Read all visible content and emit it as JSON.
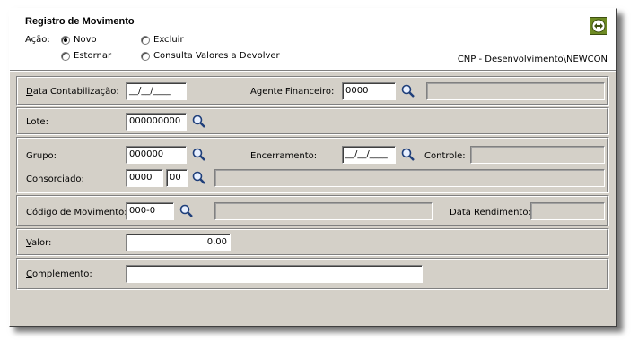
{
  "header": {
    "title": "Registro de Movimento",
    "acao_label": "Ação:",
    "options": {
      "novo": "Novo",
      "excluir": "Excluir",
      "estornar": "Estornar",
      "consulta": "Consulta Valores a Devolver"
    },
    "selected": "Novo",
    "server": "CNP - Desenvolvimento\\NEWCON"
  },
  "fields": {
    "data_contabilizacao": {
      "label": "Data Contabilização:",
      "value": "__/__/____"
    },
    "agente_financeiro": {
      "label": "Agente Financeiro:",
      "value": "0000",
      "description": ""
    },
    "lote": {
      "label": "Lote:",
      "value": "000000000"
    },
    "grupo": {
      "label": "Grupo:",
      "value": "000000"
    },
    "encerramento": {
      "label": "Encerramento:",
      "value": "__/__/____"
    },
    "controle": {
      "label": "Controle:",
      "value": ""
    },
    "consorciado": {
      "label": "Consorciado:",
      "value1": "0000",
      "value2": "00",
      "description": ""
    },
    "codigo_movimento": {
      "label": "Código de Movimento:",
      "value": "000-0",
      "description": ""
    },
    "data_rendimento": {
      "label": "Data Rendimento:",
      "value": ""
    },
    "valor": {
      "label": "Valor:",
      "value": "0,00"
    },
    "complemento": {
      "label": "Complemento:",
      "value": ""
    }
  },
  "icons": {
    "search": "magnifier-icon",
    "nav": "arrows-icon"
  },
  "colors": {
    "window_bg": "#d4d0c8",
    "header_bg": "#ffffff",
    "nav_icon": "#6e8b24"
  }
}
